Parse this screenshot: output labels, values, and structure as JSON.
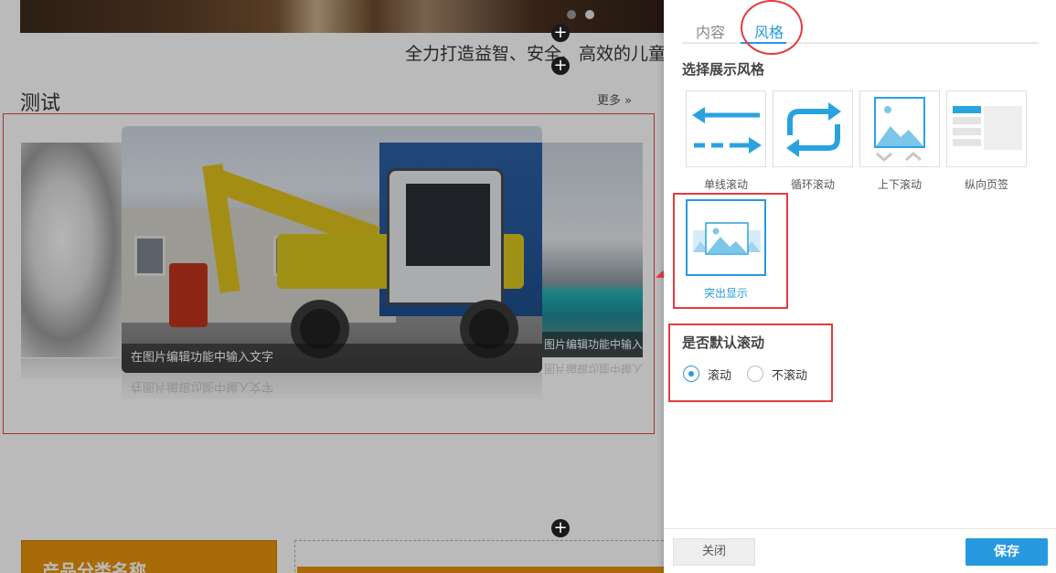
{
  "canvas": {
    "slogan": "全力打造益智、安全、高效的儿童",
    "section_title": "测试",
    "more_link": "更多 »",
    "slide_caption": "在图片编辑功能中输入文字",
    "slide_right_caption": "图片编辑功能中输入文字",
    "product_category": "产品分类名称",
    "plus_glyph": "+"
  },
  "panel": {
    "tabs": [
      {
        "label": "内容",
        "active": false
      },
      {
        "label": "风格",
        "active": true
      }
    ],
    "style_section_label": "选择展示风格",
    "styles": [
      {
        "label": "单线滚动",
        "icon": "horizontal-arrows-icon",
        "selected": false
      },
      {
        "label": "循环滚动",
        "icon": "loop-arrows-icon",
        "selected": false
      },
      {
        "label": "上下滚动",
        "icon": "vertical-scroll-icon",
        "selected": false
      },
      {
        "label": "纵向页签",
        "icon": "vertical-tabs-icon",
        "selected": false
      },
      {
        "label": "突出显示",
        "icon": "highlight-images-icon",
        "selected": true
      }
    ],
    "scroll_section_label": "是否默认滚动",
    "scroll_options": [
      {
        "label": "滚动",
        "checked": true
      },
      {
        "label": "不滚动",
        "checked": false
      }
    ],
    "close_label": "关闭",
    "save_label": "保存"
  },
  "colors": {
    "accent": "#2799e0",
    "annotation_red": "#e33c3c",
    "icon_blue": "#29a3e0",
    "category_orange": "#e8920c"
  }
}
